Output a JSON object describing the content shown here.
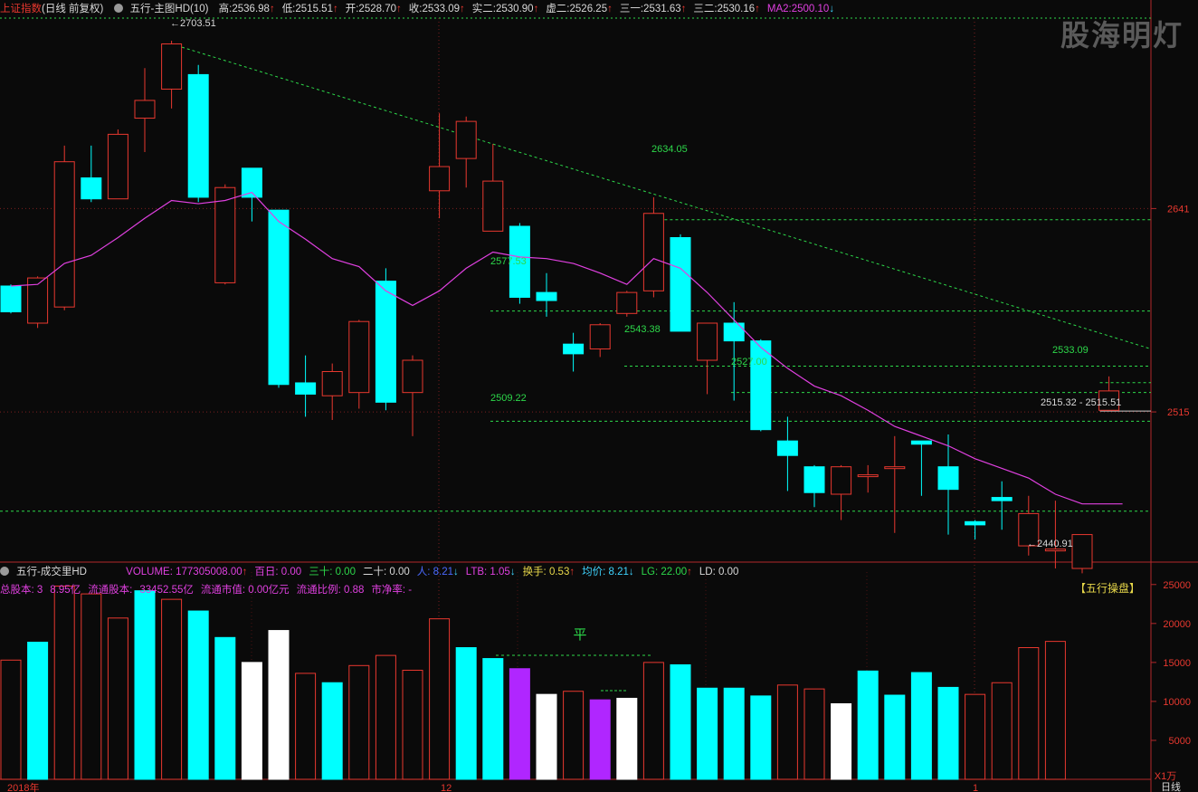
{
  "header": {
    "index_name": "上证指数",
    "period": "(日线 前复权)",
    "indicator_name": "五行-主图HD(10)",
    "stats": [
      {
        "label": "高:",
        "value": "2536.98",
        "arrow": "↑",
        "color": "#e8382f"
      },
      {
        "label": "低:",
        "value": "2515.51",
        "arrow": "↑",
        "color": "#e8382f"
      },
      {
        "label": "开:",
        "value": "2528.70",
        "arrow": "↑",
        "color": "#e8382f"
      },
      {
        "label": "收:",
        "value": "2533.09",
        "arrow": "↑",
        "color": "#e8382f"
      },
      {
        "label": "实二:",
        "value": "2530.90",
        "arrow": "↑",
        "color": "#e8382f"
      },
      {
        "label": "虚二:",
        "value": "2526.25",
        "arrow": "↑",
        "color": "#e8382f"
      },
      {
        "label": "三一:",
        "value": "2531.63",
        "arrow": "↑",
        "color": "#e8382f"
      },
      {
        "label": "三二:",
        "value": "2530.16",
        "arrow": "↑",
        "color": "#e8382f"
      },
      {
        "label": "MA2:",
        "value": "2500.10",
        "arrow": "↓",
        "color": "#e040e0"
      }
    ],
    "watermark": "股海明灯"
  },
  "volume_header": {
    "name": "五行-成交里HD",
    "items": [
      {
        "text": "VOLUME: 177305008.00",
        "arrow": "↑",
        "color": "#e040e0"
      },
      {
        "text": "百日: 0.00",
        "arrow": "",
        "color": "#e040e0"
      },
      {
        "text": "三十: 0.00",
        "arrow": "",
        "color": "#2dd84a"
      },
      {
        "text": "二十: 0.00",
        "arrow": "",
        "color": "#d8d8d8"
      },
      {
        "text": "人: 8.21",
        "arrow": "↓",
        "color": "#4a6aff"
      },
      {
        "text": "LTB: 1.05",
        "arrow": "↓",
        "color": "#e040e0"
      },
      {
        "text": "换手: 0.53",
        "arrow": "↑",
        "color": "#e8d84a"
      },
      {
        "text": "均价: 8.21",
        "arrow": "↓",
        "color": "#3fd4ff"
      },
      {
        "text": "LG: 22.00",
        "arrow": "↑",
        "color": "#2dd84a"
      },
      {
        "text": "LD: 0.00",
        "arrow": "",
        "color": "#d8d8d8"
      }
    ]
  },
  "stock_stats": [
    {
      "text": "总股本: 3",
      "color": "#e040e0"
    },
    {
      "text": "8.95亿",
      "color": "#e040e0"
    },
    {
      "text": "流通股本:",
      "color": "#e040e0"
    },
    {
      "text": "33452.55亿",
      "color": "#e040e0"
    },
    {
      "text": "流通市值: 0.00亿元",
      "color": "#e040e0"
    },
    {
      "text": "流通比例: 0.88",
      "color": "#e040e0"
    },
    {
      "text": "市净率: -",
      "color": "#e040e0"
    }
  ],
  "chart_data": [
    {
      "type": "candlestick",
      "ohlc": [
        {
          "open": 2593,
          "high": 2594,
          "low": 2576,
          "close": 2577
        },
        {
          "open": 2570,
          "high": 2599,
          "low": 2567,
          "close": 2598
        },
        {
          "open": 2580,
          "high": 2680,
          "low": 2578,
          "close": 2670
        },
        {
          "open": 2660,
          "high": 2680,
          "low": 2645,
          "close": 2647
        },
        {
          "open": 2647,
          "high": 2690,
          "low": 2647,
          "close": 2687
        },
        {
          "open": 2697,
          "high": 2728,
          "low": 2676,
          "close": 2708
        },
        {
          "open": 2715,
          "high": 2745,
          "low": 2703,
          "close": 2743
        },
        {
          "open": 2724,
          "high": 2730,
          "low": 2645,
          "close": 2648
        },
        {
          "open": 2595,
          "high": 2656,
          "low": 2594,
          "close": 2654
        },
        {
          "open": 2666,
          "high": 2666,
          "low": 2633,
          "close": 2648
        },
        {
          "open": 2640,
          "high": 2640,
          "low": 2530,
          "close": 2532
        },
        {
          "open": 2533,
          "high": 2550,
          "low": 2512,
          "close": 2526
        },
        {
          "open": 2525,
          "high": 2545,
          "low": 2510,
          "close": 2540
        },
        {
          "open": 2527,
          "high": 2572,
          "low": 2517,
          "close": 2571
        },
        {
          "open": 2596,
          "high": 2604,
          "low": 2516,
          "close": 2521
        },
        {
          "open": 2527,
          "high": 2550,
          "low": 2500,
          "close": 2547
        },
        {
          "open": 2652,
          "high": 2700,
          "low": 2635,
          "close": 2667
        },
        {
          "open": 2672,
          "high": 2698,
          "low": 2654,
          "close": 2695
        },
        {
          "open": 2627,
          "high": 2681,
          "low": 2627,
          "close": 2658
        },
        {
          "open": 2630,
          "high": 2632,
          "low": 2582,
          "close": 2586
        },
        {
          "open": 2589,
          "high": 2601,
          "low": 2574,
          "close": 2584
        },
        {
          "open": 2557,
          "high": 2564,
          "low": 2540,
          "close": 2551
        },
        {
          "open": 2554,
          "high": 2570,
          "low": 2549,
          "close": 2569
        },
        {
          "open": 2576,
          "high": 2590,
          "low": 2574,
          "close": 2589
        },
        {
          "open": 2590,
          "high": 2648,
          "low": 2586,
          "close": 2638
        },
        {
          "open": 2623,
          "high": 2625,
          "low": 2565,
          "close": 2565
        },
        {
          "open": 2547,
          "high": 2570,
          "low": 2526,
          "close": 2570
        },
        {
          "open": 2570,
          "high": 2583,
          "low": 2522,
          "close": 2559
        },
        {
          "open": 2559,
          "high": 2560,
          "low": 2503,
          "close": 2504
        },
        {
          "open": 2497,
          "high": 2512,
          "low": 2466,
          "close": 2488
        },
        {
          "open": 2481,
          "high": 2482,
          "low": 2456,
          "close": 2465
        },
        {
          "open": 2464,
          "high": 2482,
          "low": 2448,
          "close": 2481
        },
        {
          "open": 2476,
          "high": 2482,
          "low": 2465,
          "close": 2476
        },
        {
          "open": 2481,
          "high": 2500,
          "low": 2440,
          "close": 2481
        },
        {
          "open": 2497,
          "high": 2497,
          "low": 2463,
          "close": 2495
        },
        {
          "open": 2481,
          "high": 2501,
          "low": 2439,
          "close": 2467
        },
        {
          "open": 2447,
          "high": 2448,
          "low": 2436,
          "close": 2445
        },
        {
          "open": 2462,
          "high": 2472,
          "low": 2442,
          "close": 2460
        },
        {
          "open": 2432,
          "high": 2463,
          "low": 2426,
          "close": 2452
        },
        {
          "open": 2429,
          "high": 2460,
          "low": 2418,
          "close": 2430
        },
        {
          "open": 2418,
          "high": 2439,
          "low": 2415,
          "close": 2439
        },
        {
          "open": 2516,
          "high": 2537,
          "low": 2516,
          "close": 2528
        }
      ],
      "ma_line": {
        "name": "MA2",
        "values": [
          2593,
          2594,
          2607,
          2612,
          2623,
          2635,
          2646,
          2644,
          2646,
          2651,
          2633,
          2622,
          2610,
          2605,
          2590,
          2581,
          2590,
          2604,
          2614,
          2611,
          2610,
          2607,
          2601,
          2594,
          2610,
          2604,
          2589,
          2572,
          2555,
          2542,
          2531,
          2525,
          2516,
          2506,
          2500,
          2494,
          2486,
          2480,
          2474,
          2464,
          2458,
          2500
        ]
      },
      "annotations": [
        "2703.51",
        "2634.05",
        "2577.53",
        "2543.38",
        "2527.00",
        "2509.22",
        "2533.09",
        "2515.32 - 2515.51",
        "2440.91"
      ],
      "y_ticks": [
        "2641",
        "2515"
      ],
      "volume_flag": "平"
    },
    {
      "type": "bar",
      "name": "volume",
      "values": [
        15300,
        17600,
        24800,
        23800,
        20700,
        24200,
        23100,
        21600,
        18200,
        15000,
        19100,
        13600,
        12400,
        14600,
        15900,
        14000,
        20600,
        16900,
        15500,
        14200,
        10900,
        11300,
        10200,
        10400,
        15000,
        14700,
        11700,
        11700,
        10700,
        12100,
        11600,
        9700,
        13900,
        10800,
        13700,
        11800,
        10900,
        12400,
        16900,
        17700
      ],
      "y_ticks": [
        "25000",
        "20000",
        "15000",
        "10000",
        "5000"
      ],
      "unit_label": "X1万",
      "panel_label": "【五行操盘】"
    }
  ],
  "x_axis": {
    "labels": [
      "2018年",
      "12",
      "1"
    ],
    "right_label": "日线"
  }
}
